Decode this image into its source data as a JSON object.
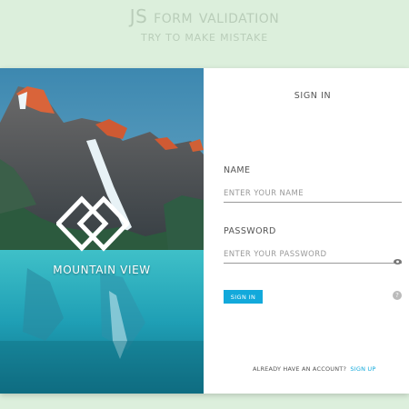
{
  "header": {
    "title": "JS form validation",
    "subtitle": "TRY TO MAKE MISTAKE"
  },
  "brand": {
    "name": "MOUNTAIN VIEW",
    "logo_icon": "double-diamond-logo"
  },
  "form": {
    "title": "SIGN IN",
    "name_label": "NAME",
    "name_placeholder": "ENTER YOUR NAME",
    "password_label": "PASSWORD",
    "password_placeholder": "ENTER YOUR PASSWORD",
    "show_password_icon": "eye-icon",
    "submit_label": "SIGN IN",
    "help_label": "?",
    "account_prompt": "ALREADY HAVE AN ACCOUNT?",
    "signup_label": "SIGN UP"
  },
  "colors": {
    "page_background": "#dcefdc",
    "accent": "#12a9db"
  }
}
